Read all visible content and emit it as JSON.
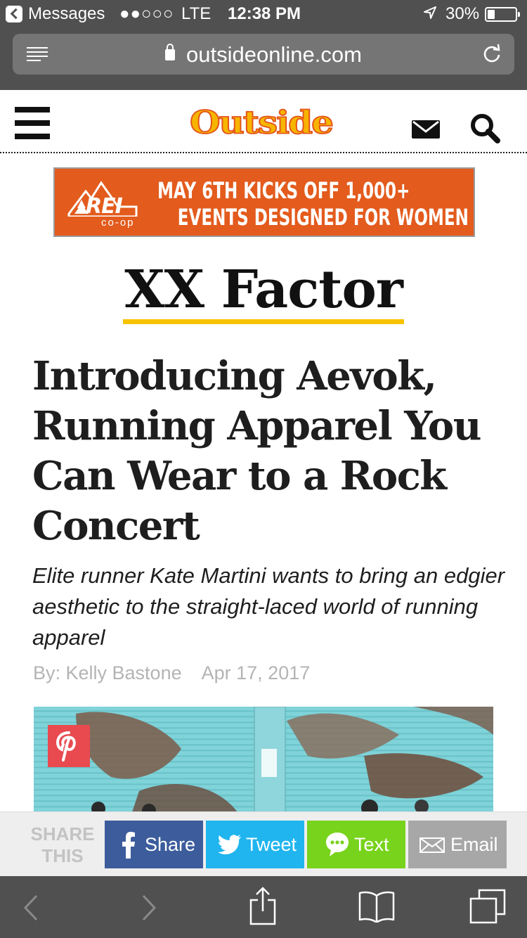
{
  "status_bar": {
    "back_app": "Messages",
    "signal": "●●○○○",
    "carrier": "LTE",
    "time": "12:38 PM",
    "battery": "30%"
  },
  "browser": {
    "url": "outsideonline.com",
    "menu_icon": "reader-icon",
    "reload_icon": "reload-icon"
  },
  "site": {
    "logo": "Outside",
    "icons": [
      "hamburger-menu-icon",
      "mail-icon",
      "search-icon"
    ]
  },
  "ad": {
    "brand": "REI",
    "brand_sub": "co-op",
    "line1": "MAY 6TH KICKS OFF 1,000+",
    "line2": "EVENTS DESIGNED FOR WOMEN",
    "color": "#e35b1d"
  },
  "article": {
    "section": "XX Factor",
    "headline": "Introducing Aevok, Running Apparel You Can Wear to a Rock Concert",
    "dek": "Elite runner Kate Martini wants to bring an edgier aesthetic to the straight-laced world of running apparel",
    "author": "By: Kelly Bastone",
    "date": "Apr 17, 2017",
    "accent": "#f7c300"
  },
  "share": {
    "label_line1": "SHARE",
    "label_line2": "THIS",
    "buttons": [
      {
        "label": "Share",
        "icon": "facebook-icon",
        "color": "#3c5c9c"
      },
      {
        "label": "Tweet",
        "icon": "twitter-icon",
        "color": "#20b5ee"
      },
      {
        "label": "Text",
        "icon": "message-bubble-icon",
        "color": "#78d31c"
      },
      {
        "label": "Email",
        "icon": "envelope-icon",
        "color": "#a7a7a7"
      }
    ]
  },
  "toolbar": {
    "icons": [
      "back-icon",
      "forward-icon",
      "share-icon",
      "bookmarks-icon",
      "tabs-icon"
    ]
  }
}
